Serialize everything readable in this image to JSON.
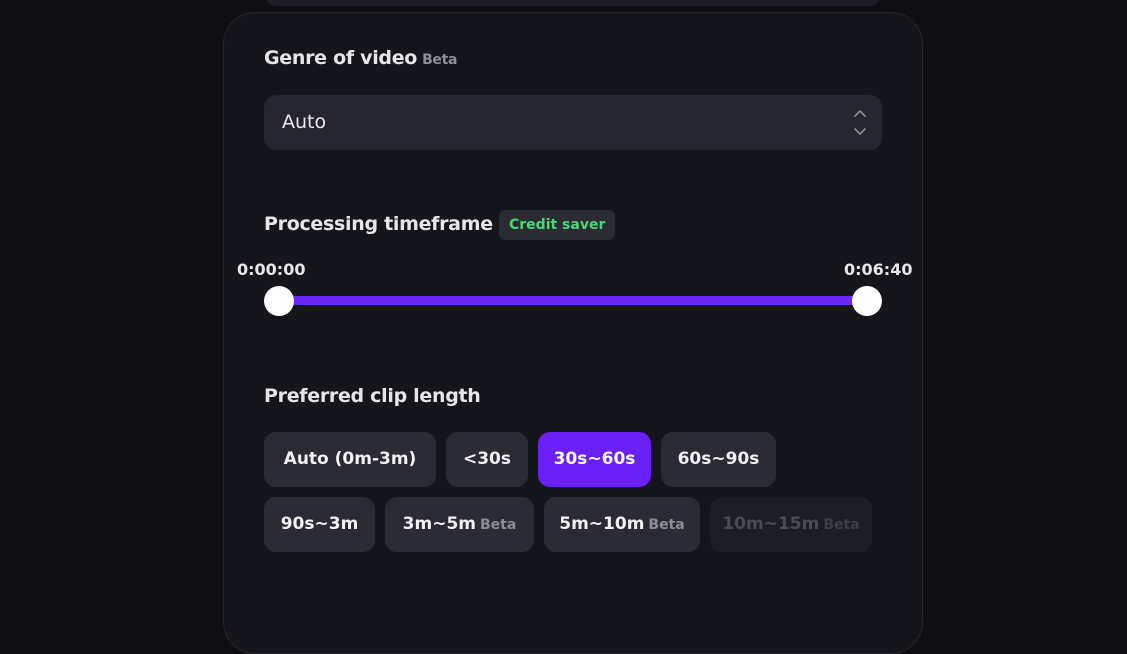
{
  "genre": {
    "label": "Genre of video",
    "beta": "Beta",
    "selected": "Auto"
  },
  "timeframe": {
    "label": "Processing timeframe",
    "badge": "Credit saver",
    "start": "0:00:00",
    "end": "0:06:40",
    "start_fraction": 0,
    "end_fraction": 1
  },
  "clip_length": {
    "label": "Preferred clip length",
    "options": [
      {
        "label": "Auto (0m-3m)",
        "beta": "",
        "state": "default"
      },
      {
        "label": "<30s",
        "beta": "",
        "state": "default"
      },
      {
        "label": "30s~60s",
        "beta": "",
        "state": "selected"
      },
      {
        "label": "60s~90s",
        "beta": "",
        "state": "default"
      },
      {
        "label": "90s~3m",
        "beta": "",
        "state": "default"
      },
      {
        "label": "3m~5m",
        "beta": "Beta",
        "state": "default"
      },
      {
        "label": "5m~10m",
        "beta": "Beta",
        "state": "default"
      },
      {
        "label": "10m~15m",
        "beta": "Beta",
        "state": "disabled"
      }
    ]
  },
  "colors": {
    "accent": "#6a20f7",
    "badge_text": "#4dd675",
    "panel": "#15161c"
  }
}
